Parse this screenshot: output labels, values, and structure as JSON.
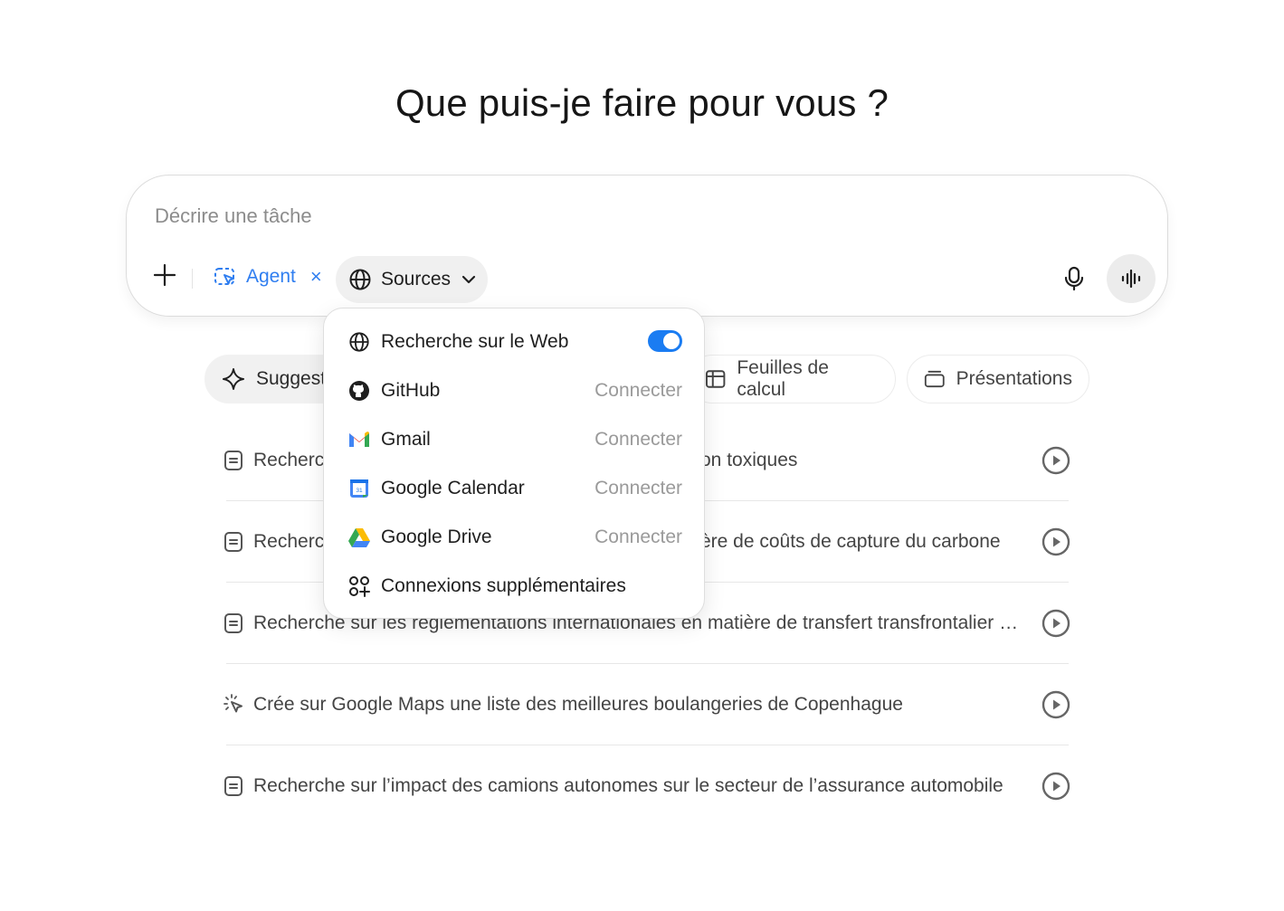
{
  "heading": "Que puis-je faire pour vous ?",
  "composer": {
    "placeholder": "Décrire une tâche",
    "agent_label": "Agent",
    "agent_remove": "×",
    "sources_label": "Sources"
  },
  "chips": {
    "suggest": "Suggest",
    "sheets": "Feuilles de calcul",
    "slides": "Présentations"
  },
  "suggestions": [
    {
      "icon": "document-icon",
      "text": "Recherch",
      "tail": "on toxiques"
    },
    {
      "icon": "document-icon",
      "text": "Recherch",
      "tail": "ère de coûts de capture du carbone"
    },
    {
      "icon": "document-icon",
      "text": "Recherche sur les réglementations internationales en matière de transfert transfrontalier d..."
    },
    {
      "icon": "cursor-click-icon",
      "text": "Crée sur Google Maps une liste des meilleures boulangeries de Copenhague"
    },
    {
      "icon": "document-icon",
      "text": "Recherche sur l’impact des camions autonomes sur le secteur de l’assurance automobile"
    }
  ],
  "sources_menu": {
    "web": {
      "label": "Recherche sur le Web",
      "enabled": true
    },
    "github": {
      "label": "GitHub",
      "action": "Connecter"
    },
    "gmail": {
      "label": "Gmail",
      "action": "Connecter"
    },
    "calendar": {
      "label": "Google Calendar",
      "action": "Connecter",
      "icon_text": "31"
    },
    "drive": {
      "label": "Google Drive",
      "action": "Connecter"
    },
    "more": {
      "label": "Connexions supplémentaires"
    }
  },
  "colors": {
    "accent": "#1a7cf2",
    "agent": "#2f7ef0"
  }
}
